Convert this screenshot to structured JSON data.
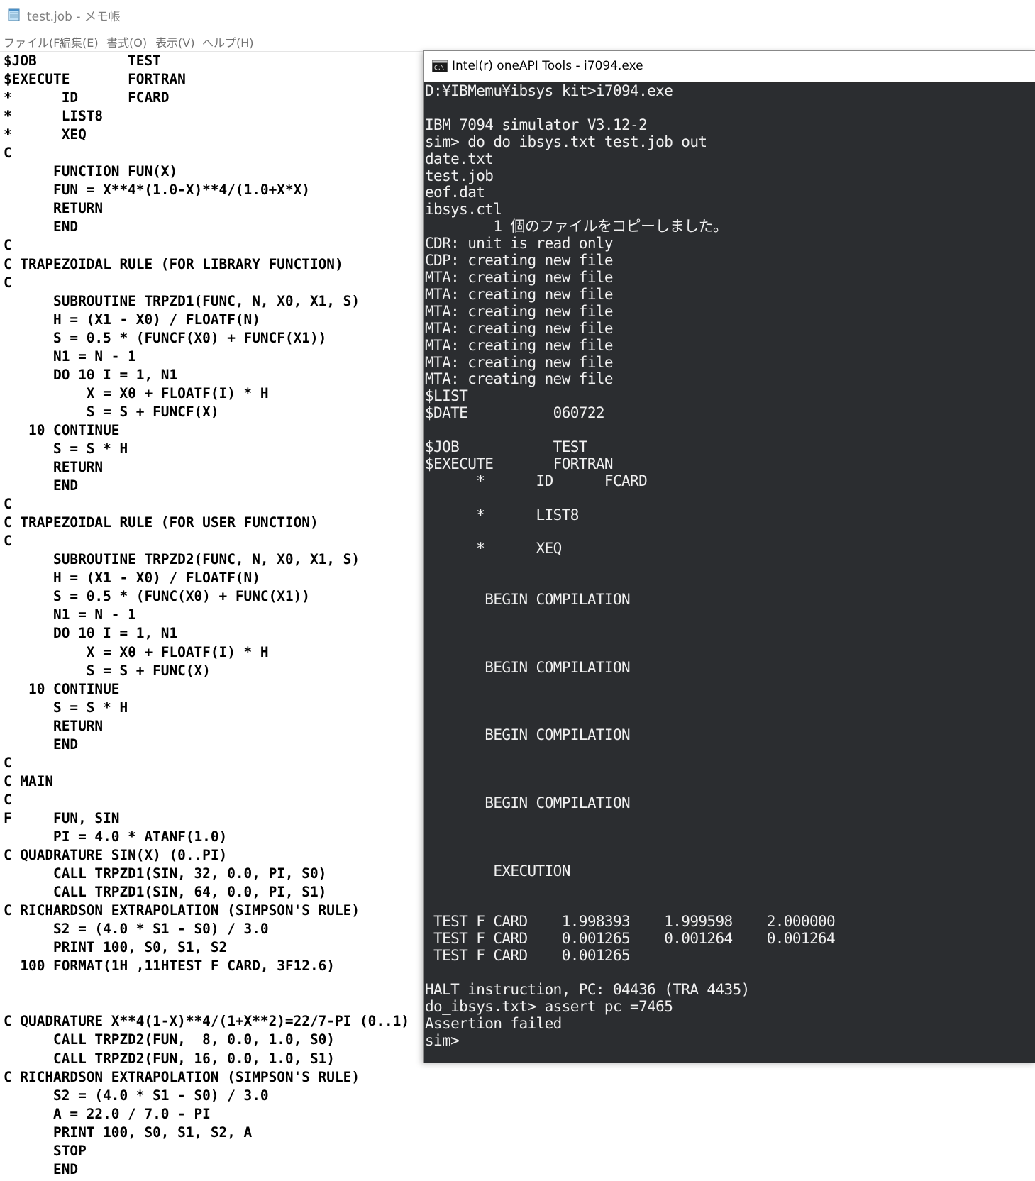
{
  "notepad": {
    "title": "test.job - メモ帳",
    "menu": [
      "ファイル(F)",
      "編集(E)",
      "書式(O)",
      "表示(V)",
      "ヘルプ(H)"
    ],
    "text": "$JOB           TEST\n$EXECUTE       FORTRAN\n*      ID      FCARD\n*      LIST8\n*      XEQ\nC\n      FUNCTION FUN(X)\n      FUN = X**4*(1.0-X)**4/(1.0+X*X)\n      RETURN\n      END\nC\nC TRAPEZOIDAL RULE (FOR LIBRARY FUNCTION)\nC\n      SUBROUTINE TRPZD1(FUNC, N, X0, X1, S)\n      H = (X1 - X0) / FLOATF(N)\n      S = 0.5 * (FUNCF(X0) + FUNCF(X1))\n      N1 = N - 1\n      DO 10 I = 1, N1\n          X = X0 + FLOATF(I) * H\n          S = S + FUNCF(X)\n   10 CONTINUE\n      S = S * H\n      RETURN\n      END\nC\nC TRAPEZOIDAL RULE (FOR USER FUNCTION)\nC\n      SUBROUTINE TRPZD2(FUNC, N, X0, X1, S)\n      H = (X1 - X0) / FLOATF(N)\n      S = 0.5 * (FUNC(X0) + FUNC(X1))\n      N1 = N - 1\n      DO 10 I = 1, N1\n          X = X0 + FLOATF(I) * H\n          S = S + FUNC(X)\n   10 CONTINUE\n      S = S * H\n      RETURN\n      END\nC\nC MAIN\nC\nF     FUN, SIN\n      PI = 4.0 * ATANF(1.0)\nC QUADRATURE SIN(X) (0..PI)\n      CALL TRPZD1(SIN, 32, 0.0, PI, S0)\n      CALL TRPZD1(SIN, 64, 0.0, PI, S1)\nC RICHARDSON EXTRAPOLATION (SIMPSON'S RULE)\n      S2 = (4.0 * S1 - S0) / 3.0\n      PRINT 100, S0, S1, S2\n  100 FORMAT(1H ,11HTEST F CARD, 3F12.6)\n\n\nC QUADRATURE X**4(1-X)**4/(1+X**2)=22/7-PI (0..1)\n      CALL TRPZD2(FUN,  8, 0.0, 1.0, S0)\n      CALL TRPZD2(FUN, 16, 0.0, 1.0, S1)\nC RICHARDSON EXTRAPOLATION (SIMPSON'S RULE)\n      S2 = (4.0 * S1 - S0) / 3.0\n      A = 22.0 / 7.0 - PI\n      PRINT 100, S0, S1, S2, A\n      STOP\n      END"
  },
  "console": {
    "title": "Intel(r) oneAPI Tools - i7094.exe",
    "text": "D:¥IBMemu¥ibsys_kit>i7094.exe\n\nIBM 7094 simulator V3.12-2\nsim> do do_ibsys.txt test.job out\ndate.txt\ntest.job\neof.dat\nibsys.ctl\n        1 個のファイルをコピーしました。\nCDR: unit is read only\nCDP: creating new file\nMTA: creating new file\nMTA: creating new file\nMTA: creating new file\nMTA: creating new file\nMTA: creating new file\nMTA: creating new file\nMTA: creating new file\n$LIST\n$DATE          060722\n\n$JOB           TEST\n$EXECUTE       FORTRAN\n      *      ID      FCARD\n\n      *      LIST8\n\n      *      XEQ\n\n\n       BEGIN COMPILATION\n\n\n\n       BEGIN COMPILATION\n\n\n\n       BEGIN COMPILATION\n\n\n\n       BEGIN COMPILATION\n\n\n\n        EXECUTION\n\n\n TEST F CARD    1.998393    1.999598    2.000000\n TEST F CARD    0.001265    0.001264    0.001264\n TEST F CARD    0.001265\n\nHALT instruction, PC: 04436 (TRA 4435)\ndo_ibsys.txt> assert pc =7465\nAssertion failed\nsim>"
  }
}
